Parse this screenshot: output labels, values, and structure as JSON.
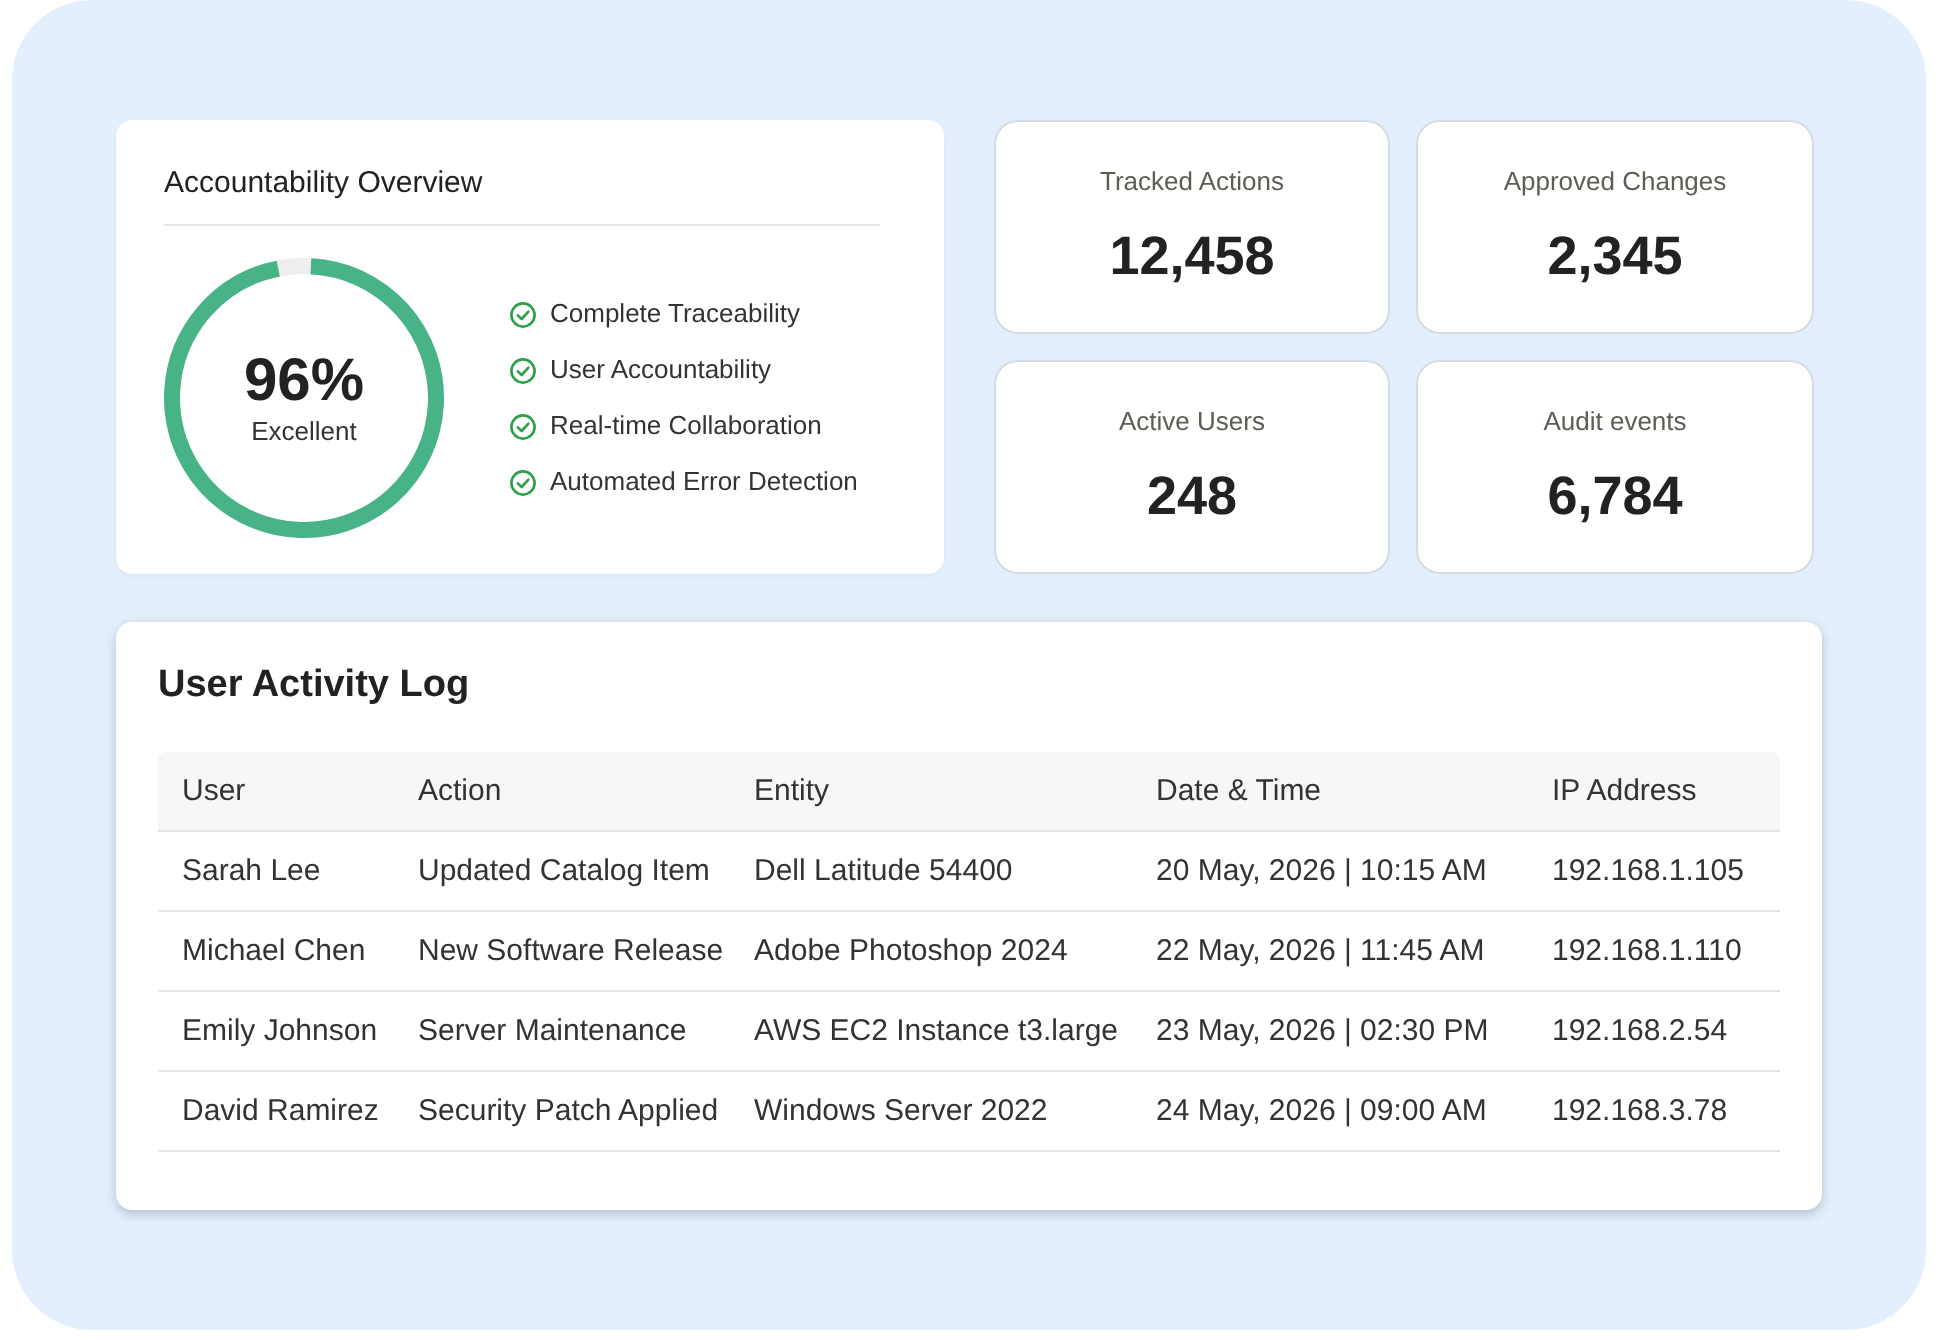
{
  "overview": {
    "title": "Accountability Overview",
    "score": {
      "value": "96%",
      "label": "Excellent",
      "level": 0.96
    },
    "features": [
      {
        "label": "Complete Traceability",
        "checked": true
      },
      {
        "label": "User Accountability",
        "checked": true
      },
      {
        "label": "Real-time Collaboration",
        "checked": true
      },
      {
        "label": "Automated Error Detection",
        "checked": true
      }
    ]
  },
  "stats": [
    {
      "label": "Tracked Actions",
      "value": "12,458"
    },
    {
      "label": "Approved Changes",
      "value": "2,345"
    },
    {
      "label": "Active Users",
      "value": "248"
    },
    {
      "label": "Audit events",
      "value": "6,784"
    }
  ],
  "activity_log": {
    "title": "User Activity Log",
    "columns": [
      "User",
      "Action",
      "Entity",
      "Date & Time",
      "IP Address"
    ],
    "rows": [
      [
        "Sarah Lee",
        "Updated Catalog Item",
        "Dell Latitude 54400",
        "20 May, 2026 | 10:15 AM",
        "192.168.1.105"
      ],
      [
        "Michael Chen",
        "New Software Release",
        "Adobe Photoshop 2024",
        "22 May, 2026 | 11:45 AM",
        "192.168.1.110"
      ],
      [
        "Emily Johnson",
        "Server Maintenance",
        "AWS EC2 Instance t3.large",
        "23 May, 2026 | 02:30 PM",
        "192.168.2.54"
      ],
      [
        "David Ramirez",
        "Security Patch Applied",
        "Windows Server 2022",
        "24 May, 2026 | 09:00 AM",
        "192.168.3.78"
      ]
    ]
  }
}
